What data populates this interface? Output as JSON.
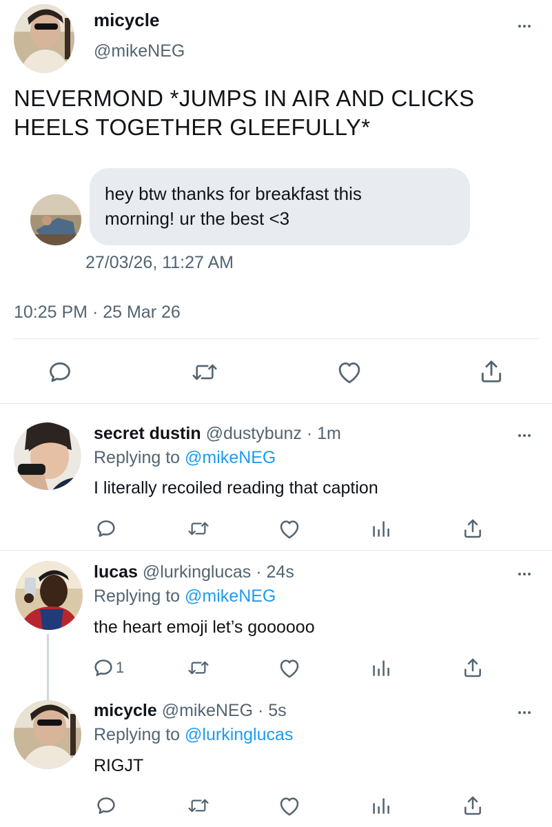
{
  "main_tweet": {
    "author_name": "micycle",
    "author_handle": "@mikeNEG",
    "text_line1": "NEVERMOND *JUMPS IN AIR AND CLICKS",
    "text_line2": "HEELS TOGETHER GLEEFULLY*",
    "embedded_message": {
      "line1": "hey btw thanks for breakfast this",
      "line2": "morning! ur the best <3",
      "timestamp": "27/03/26, 11:27 AM"
    },
    "timestamp": "10:25 PM · 25 Mar 26"
  },
  "replies": [
    {
      "name": "secret dustin",
      "handle": "@dustybunz",
      "time": "· 1m",
      "replying_label": "Replying to",
      "replying_to": "@mikeNEG",
      "text": "I literally recoiled reading that caption",
      "reply_count": ""
    },
    {
      "name": "lucas",
      "handle": "@lurkinglucas",
      "time": "· 24s",
      "replying_label": "Replying to",
      "replying_to": "@mikeNEG",
      "text": "the heart emoji let’s goooooo",
      "reply_count": "1"
    },
    {
      "name": "micycle",
      "handle": "@mikeNEG",
      "time": "· 5s",
      "replying_label": "Replying to",
      "replying_to": "@lurkinglucas",
      "text": "RIGJT",
      "reply_count": ""
    }
  ],
  "icons": {
    "reply": "speech-bubble-icon",
    "retweet": "retweet-icon",
    "like": "heart-icon",
    "share": "share-icon",
    "analytics": "bar-chart-icon",
    "more": "more-dots-icon"
  },
  "colors": {
    "text": "#0f1419",
    "secondary": "#536471",
    "link": "#1d9bf0",
    "bubble": "#e8ecf0",
    "separator": "#e6e9ec"
  }
}
